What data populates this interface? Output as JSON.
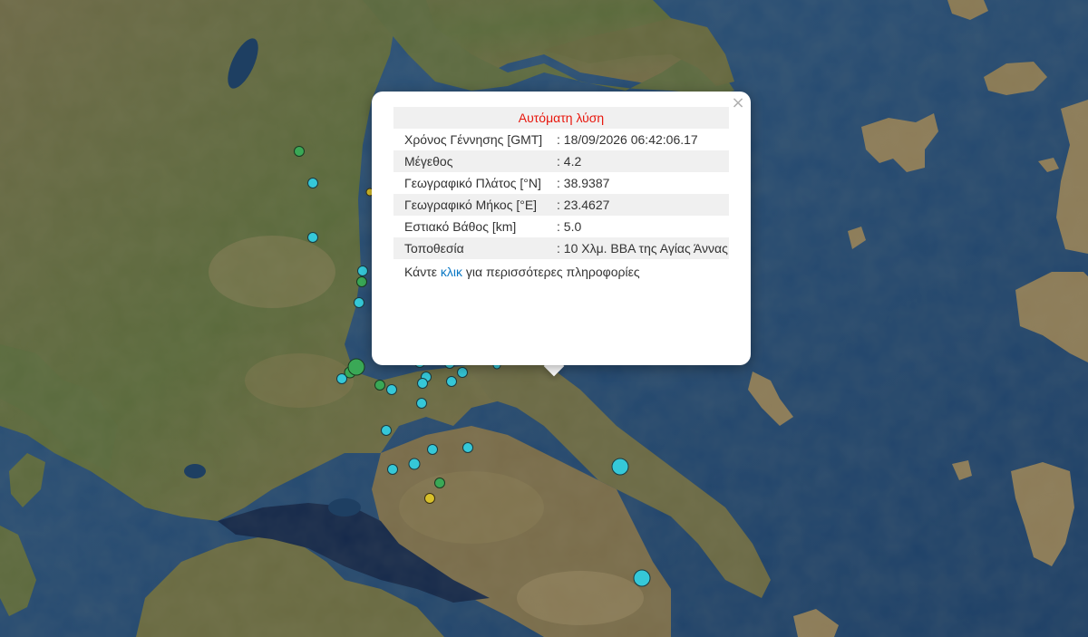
{
  "popup": {
    "title": "Αυτόματη λύση",
    "close_glyph": "×",
    "fields": [
      {
        "label": "Χρόνος Γέννησης [GMT]",
        "value": ": 18/09/2026 06:42:06.17"
      },
      {
        "label": "Μέγεθος",
        "value": ": 4.2"
      },
      {
        "label": "Γεωγραφικό Πλάτος [°N]",
        "value": ": 38.9387"
      },
      {
        "label": "Γεωγραφικό Μήκος [°E]",
        "value": ": 23.4627"
      },
      {
        "label": "Εστιακό Βάθος [km]",
        "value": ": 5.0"
      },
      {
        "label": "Τοποθεσία",
        "value": ": 10 Χλμ. ΒΒΑ της Αγίας Άννας"
      }
    ],
    "footer_prefix": "Κάντε ",
    "footer_link": "κλικ",
    "footer_suffix": " για περισσότερες πληροφορίες"
  },
  "colors": {
    "sea_deep": "#1b3d63",
    "sea": "#2a5178",
    "land_green": "#4f6a38",
    "land_brown": "#8a7650",
    "marker_cyan": "#35c8d8",
    "marker_green": "#3aa856",
    "marker_yellow": "#d8c02a",
    "title_red": "#e8160c",
    "link_blue": "#0b78c4"
  },
  "icons": {
    "close": "close-icon"
  }
}
